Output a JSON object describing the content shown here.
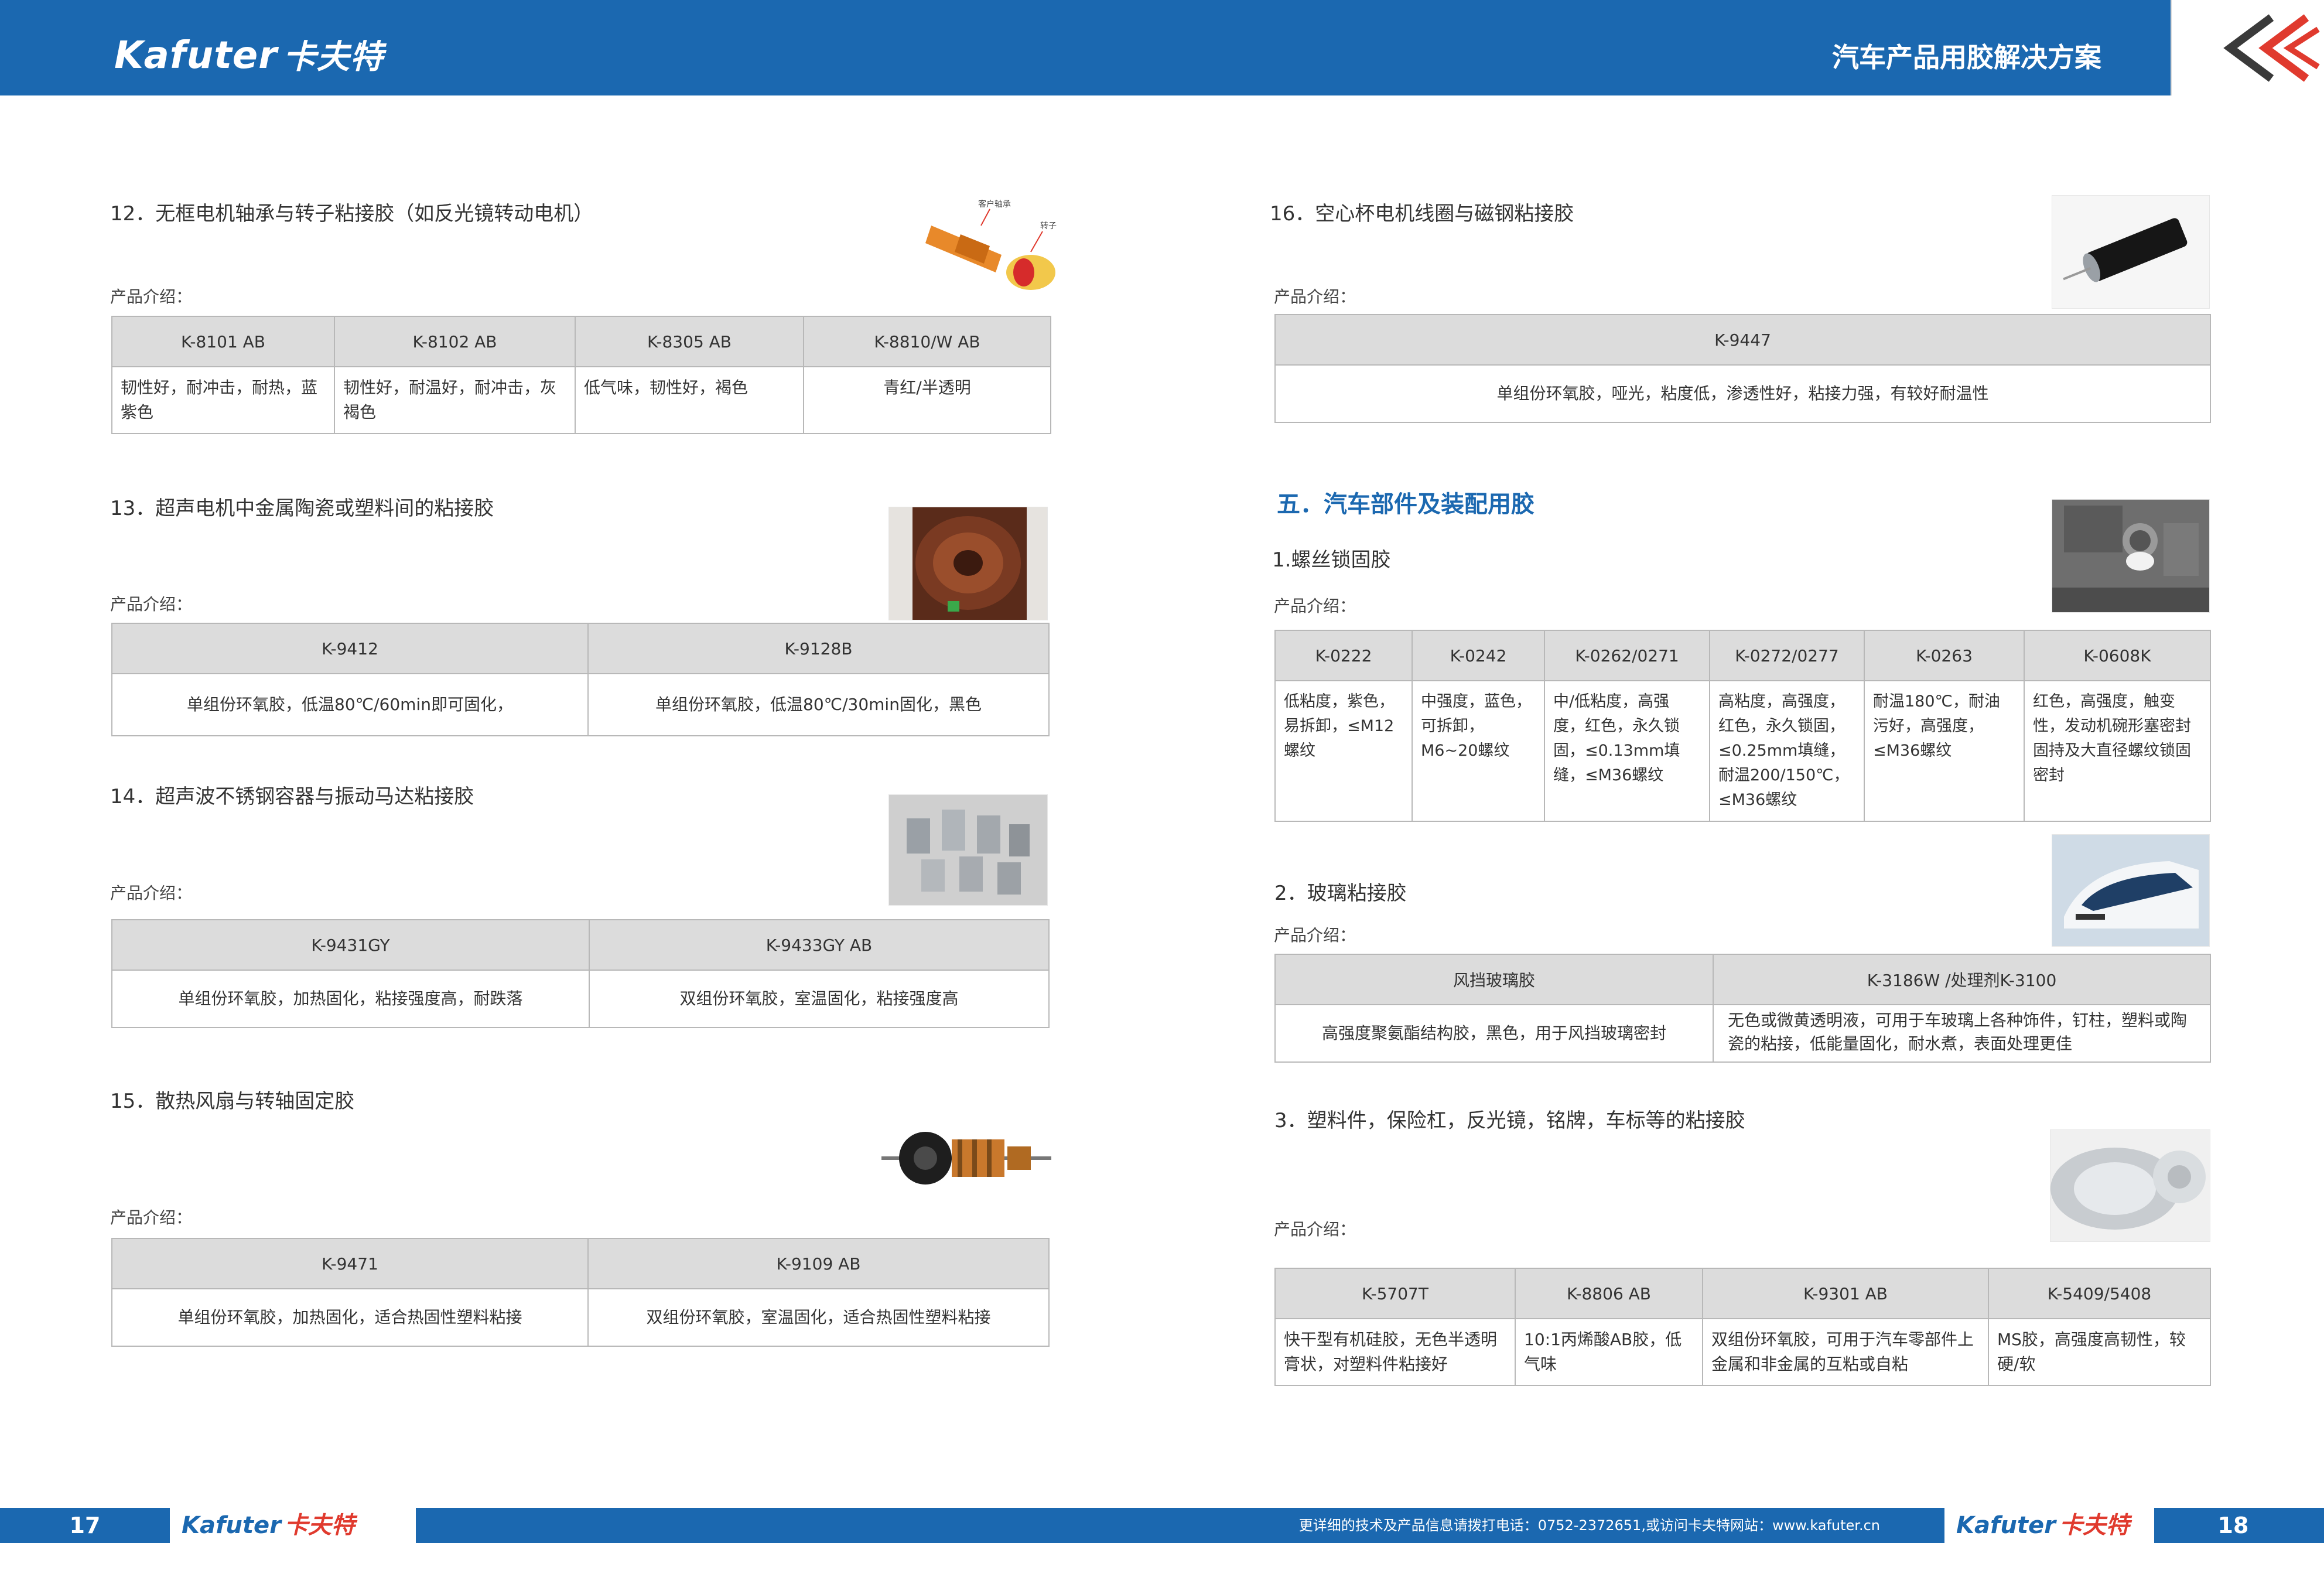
{
  "header": {
    "logo_en": "Kafuter",
    "logo_cn": "卡夫特",
    "title": "汽车产品用胶解决方案"
  },
  "footer": {
    "page_left": "17",
    "page_right": "18",
    "logo_en": "Kafuter",
    "logo_cn": "卡夫特",
    "contact": "更详细的技术及产品信息请拨打电话：0752-2372651,或访问卡夫特网站：www.kafuter.cn"
  },
  "intro_label": "产品介绍：",
  "left": {
    "s12": {
      "title": "12．无框电机轴承与转子粘接胶（如反光镜转动电机）",
      "image_labels": [
        "客户轴承",
        "转子"
      ],
      "headers": [
        "K-8101 AB",
        "K-8102 AB",
        "K-8305 AB",
        "K-8810/W AB"
      ],
      "cells": [
        "韧性好，耐冲击，耐热，蓝紫色",
        "韧性好，耐温好，耐冲击，灰褐色",
        "低气味，韧性好，褐色",
        "青红/半透明"
      ]
    },
    "s13": {
      "title": "13．超声电机中金属陶瓷或塑料间的粘接胶",
      "headers": [
        "K-9412",
        "K-9128B"
      ],
      "cells": [
        "单组份环氧胶，低温80℃/60min即可固化，",
        "单组份环氧胶，低温80℃/30min固化，黑色"
      ]
    },
    "s14": {
      "title": "14．超声波不锈钢容器与振动马达粘接胶",
      "headers": [
        "K-9431GY",
        "K-9433GY AB"
      ],
      "cells": [
        "单组份环氧胶，加热固化，粘接强度高，耐跌落",
        "双组份环氧胶，室温固化，粘接强度高"
      ]
    },
    "s15": {
      "title": "15．散热风扇与转轴固定胶",
      "headers": [
        "K-9471",
        "K-9109 AB"
      ],
      "cells": [
        "单组份环氧胶，加热固化，适合热固性塑料粘接",
        "双组份环氧胶，室温固化，适合热固性塑料粘接"
      ]
    }
  },
  "right": {
    "s16": {
      "title": "16．空心杯电机线圈与磁钢粘接胶",
      "headers": [
        "K-9447"
      ],
      "cells": [
        "单组份环氧胶，哑光，粘度低，渗透性好，粘接力强，有较好耐温性"
      ]
    },
    "heading": "五．汽车部件及装配用胶",
    "p1": {
      "title": "1.螺丝锁固胶",
      "headers": [
        "K-0222",
        "K-0242",
        "K-0262/0271",
        "K-0272/0277",
        "K-0263",
        "K-0608K"
      ],
      "cells": [
        "低粘度，紫色，易拆卸，≤M12螺纹",
        "中强度，蓝色，可拆卸，M6~20螺纹",
        "中/低粘度，高强度，红色，永久锁固，≤0.13mm填缝，≤M36螺纹",
        "高粘度，高强度，红色，永久锁固，≤0.25mm填缝，耐温200/150℃，≤M36螺纹",
        "耐温180℃，耐油污好，高强度，≤M36螺纹",
        "红色，高强度，触变性，发动机碗形塞密封固持及大直径螺纹锁固密封"
      ]
    },
    "p2": {
      "title": "2．玻璃粘接胶",
      "headers": [
        "风挡玻璃胶",
        "K-3186W /处理剂K-3100"
      ],
      "cells": [
        "高强度聚氨酯结构胶，黑色，用于风挡玻璃密封",
        "无色或微黄透明液，可用于车玻璃上各种饰件，钉柱，塑料或陶瓷的粘接，低能量固化，耐水煮，表面处理更佳"
      ]
    },
    "p3": {
      "title": "3．塑料件，保险杠，反光镜，铭牌，车标等的粘接胶",
      "headers": [
        "K-5707T",
        "K-8806 AB",
        "K-9301 AB",
        "K-5409/5408"
      ],
      "cells": [
        "快干型有机硅胶，无色半透明膏状，对塑料件粘接好",
        "10:1丙烯酸AB胶，低气味",
        "双组份环氧胶，可用于汽车零部件上金属和非金属的互粘或自粘",
        "MS胶，高强度高韧性，较硬/软"
      ]
    }
  }
}
